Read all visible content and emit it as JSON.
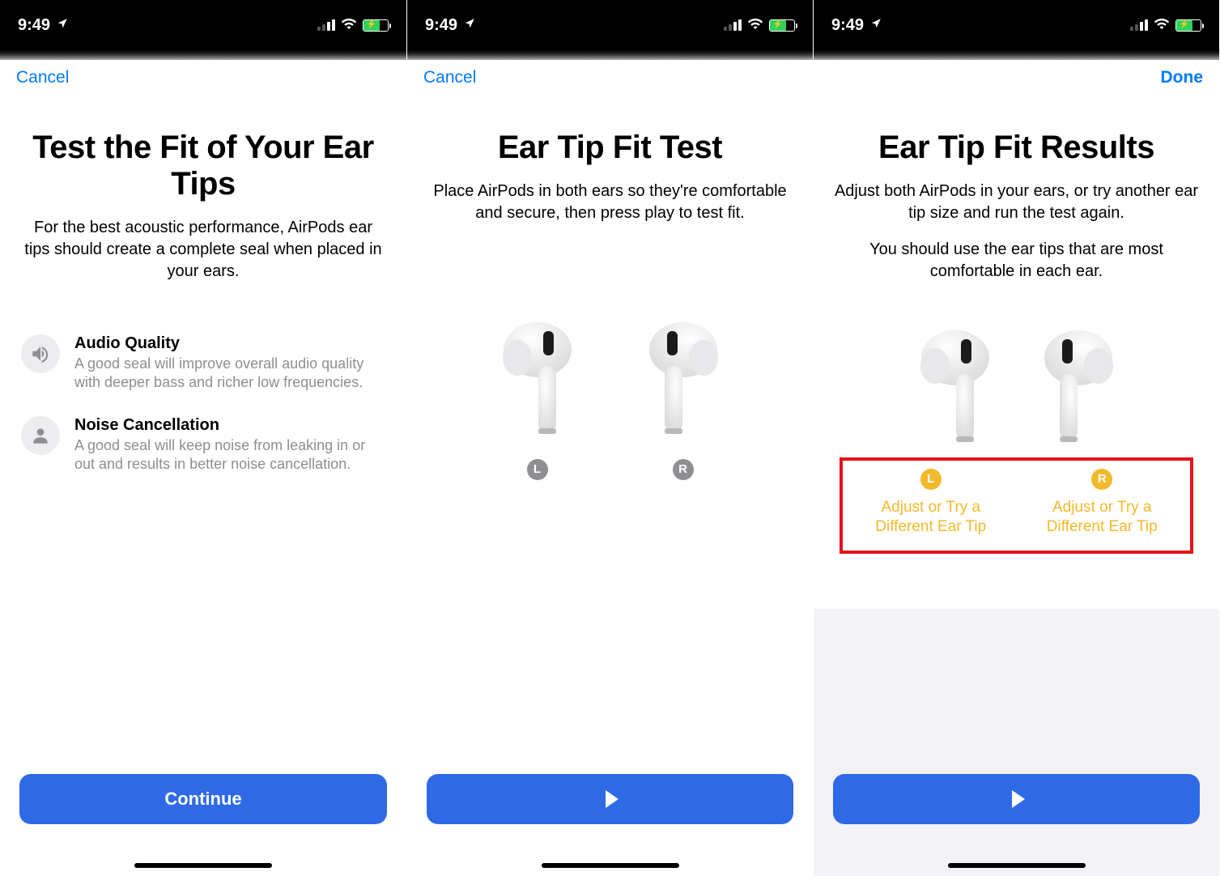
{
  "status": {
    "time": "9:49"
  },
  "colors": {
    "accent": "#007aff",
    "primary_button": "#2e6ae6",
    "warn": "#f2b92b",
    "highlight_border": "#e6121b"
  },
  "screen1": {
    "nav": {
      "left": "Cancel"
    },
    "title": "Test the Fit of Your Ear Tips",
    "subtitle": "For the best acoustic performance, AirPods ear tips should create a complete seal when placed in your ears.",
    "features": [
      {
        "title": "Audio Quality",
        "desc": "A good seal will improve overall audio quality with deeper bass and richer low frequencies."
      },
      {
        "title": "Noise Cancellation",
        "desc": "A good seal will keep noise from leaking in or out and results in better noise cancellation."
      }
    ],
    "button": "Continue"
  },
  "screen2": {
    "nav": {
      "left": "Cancel"
    },
    "title": "Ear Tip Fit Test",
    "subtitle": "Place AirPods in both ears so they're comfortable and secure, then press play to test fit.",
    "left_label": "L",
    "right_label": "R",
    "button_icon": "play"
  },
  "screen3": {
    "nav": {
      "right": "Done"
    },
    "title": "Ear Tip Fit Results",
    "subtitle1": "Adjust both AirPods in your ears, or try another ear tip size and run the test again.",
    "subtitle2": "You should use the ear tips that are most comfortable in each ear.",
    "results": {
      "left": {
        "badge": "L",
        "text": "Adjust or Try a Different Ear Tip"
      },
      "right": {
        "badge": "R",
        "text": "Adjust or Try a Different Ear Tip"
      }
    },
    "button_icon": "play"
  }
}
